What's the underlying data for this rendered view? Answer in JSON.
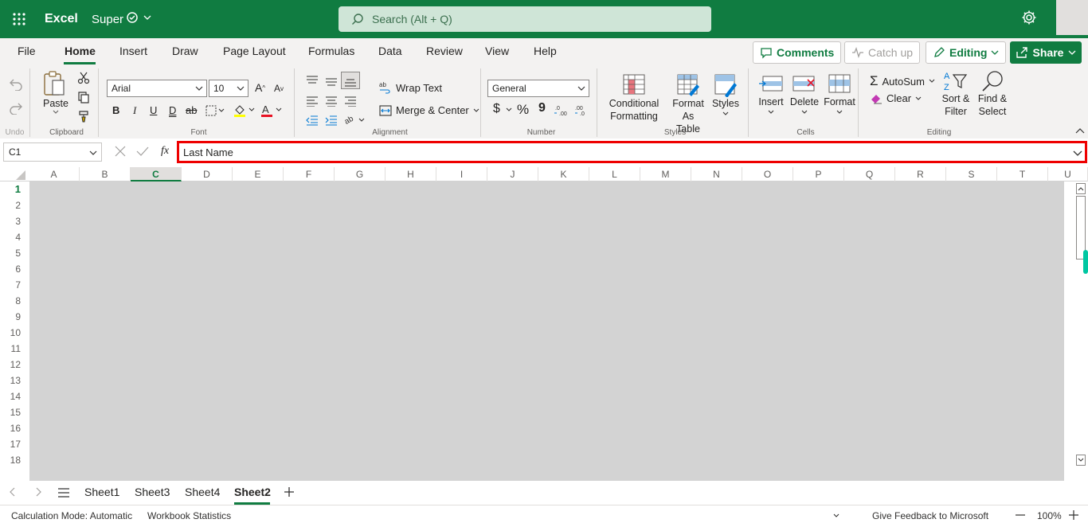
{
  "app": {
    "name": "Excel",
    "file_name": "Super"
  },
  "search": {
    "placeholder": "Search (Alt + Q)"
  },
  "tabs": [
    "File",
    "Home",
    "Insert",
    "Draw",
    "Page Layout",
    "Formulas",
    "Data",
    "Review",
    "View",
    "Help"
  ],
  "active_tab": "Home",
  "top_buttons": {
    "comments": "Comments",
    "catch_up": "Catch up",
    "editing": "Editing",
    "share": "Share"
  },
  "ribbon": {
    "undo_group": {
      "label": "Undo"
    },
    "clipboard": {
      "paste": "Paste",
      "label": "Clipboard"
    },
    "font": {
      "family": "Arial",
      "size": "10",
      "bold": "B",
      "italic": "I",
      "underline": "U",
      "double_underline": "D",
      "strike": "ab",
      "label": "Font"
    },
    "alignment": {
      "wrap_text": "Wrap Text",
      "merge_center": "Merge & Center",
      "label": "Alignment"
    },
    "number": {
      "format": "General",
      "currency": "$",
      "percent": "%",
      "comma": "9",
      "label": "Number"
    },
    "styles": {
      "conditional_1": "Conditional",
      "conditional_2": "Formatting",
      "format_as_1": "Format As",
      "format_as_2": "Table",
      "styles": "Styles",
      "label": "Styles"
    },
    "cells": {
      "insert": "Insert",
      "delete": "Delete",
      "format": "Format",
      "label": "Cells"
    },
    "editing": {
      "autosum": "AutoSum",
      "clear": "Clear",
      "sort_1": "Sort &",
      "sort_2": "Filter",
      "find_1": "Find &",
      "find_2": "Select",
      "label": "Editing"
    }
  },
  "formula_bar": {
    "name_box": "C1",
    "fx": "fx",
    "value": "Last Name"
  },
  "columns": [
    "A",
    "B",
    "C",
    "D",
    "E",
    "F",
    "G",
    "H",
    "I",
    "J",
    "K",
    "L",
    "M",
    "N",
    "O",
    "P",
    "Q",
    "R",
    "S",
    "T",
    "U"
  ],
  "selected_column": "C",
  "rows": [
    "1",
    "2",
    "3",
    "4",
    "5",
    "6",
    "7",
    "8",
    "9",
    "10",
    "11",
    "12",
    "13",
    "14",
    "15",
    "16",
    "17",
    "18"
  ],
  "selected_row": "1",
  "sheets": [
    "Sheet1",
    "Sheet3",
    "Sheet4",
    "Sheet2"
  ],
  "active_sheet": "Sheet2",
  "status": {
    "calc_mode": "Calculation Mode: Automatic",
    "workbook_stats": "Workbook Statistics",
    "feedback": "Give Feedback to Microsoft",
    "zoom": "100%"
  },
  "colors": {
    "brand": "#107c41",
    "highlight_border": "#ee0000",
    "grid_fill": "#d3d3d3"
  }
}
